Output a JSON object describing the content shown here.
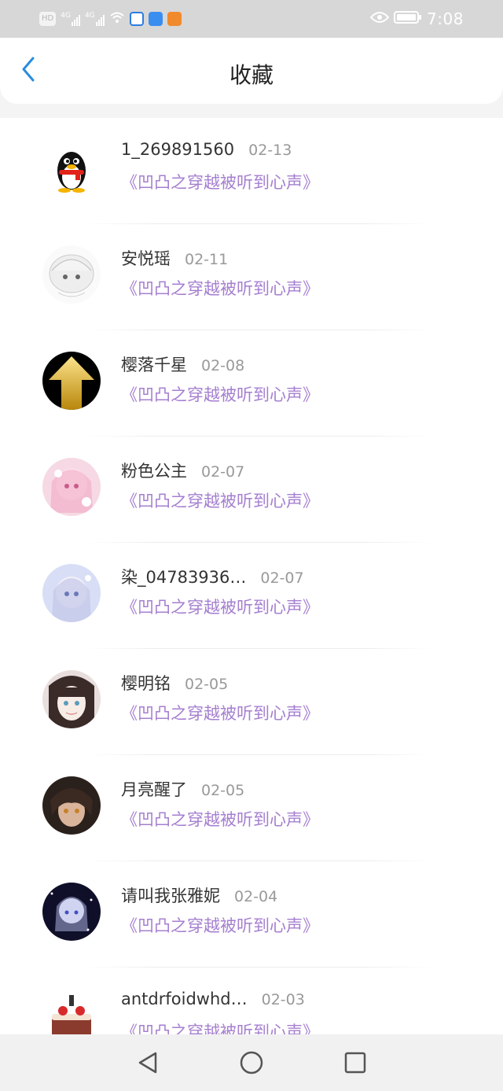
{
  "status_bar": {
    "left_chip": "HD",
    "signal1": "4G",
    "signal2": "4G",
    "time": "7:08"
  },
  "header": {
    "title": "收藏"
  },
  "colors": {
    "accent_blue": "#2a8ddf",
    "book_title_purple": "#a57fd0"
  },
  "items": [
    {
      "name": "1_269891560",
      "date": "02-13",
      "book": "《凹凸之穿越被听到心声》",
      "avatar": "penguin-avatar"
    },
    {
      "name": "安悦瑶",
      "date": "02-11",
      "book": "《凹凸之穿越被听到心声》",
      "avatar": "anime-sketch-avatar"
    },
    {
      "name": "樱落千星",
      "date": "02-08",
      "book": "《凹凸之穿越被听到心声》",
      "avatar": "gold-arrow-avatar"
    },
    {
      "name": "粉色公主",
      "date": "02-07",
      "book": "《凹凸之穿越被听到心声》",
      "avatar": "pink-anime-avatar"
    },
    {
      "name": "染_04783936…",
      "date": "02-07",
      "book": "《凹凸之穿越被听到心声》",
      "avatar": "silver-anime-avatar"
    },
    {
      "name": "樱明铭",
      "date": "02-05",
      "book": "《凹凸之穿越被听到心声》",
      "avatar": "dark-hair-anime-avatar"
    },
    {
      "name": "月亮醒了",
      "date": "02-05",
      "book": "《凹凸之穿越被听到心声》",
      "avatar": "brown-hair-anime-avatar"
    },
    {
      "name": "请叫我张雅妮",
      "date": "02-04",
      "book": "《凹凸之穿越被听到心声》",
      "avatar": "night-anime-avatar"
    },
    {
      "name": "antdrfoidwhd…",
      "date": "02-03",
      "book": "《凹凸之穿越被听到心声》",
      "avatar": "cake-avatar"
    }
  ]
}
